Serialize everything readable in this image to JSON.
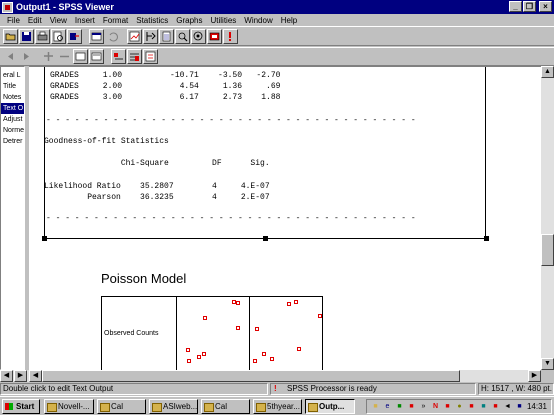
{
  "window": {
    "title": "Output1 - SPSS Viewer",
    "controls": [
      "_",
      "❐",
      "×"
    ]
  },
  "menu": [
    "File",
    "Edit",
    "View",
    "Insert",
    "Format",
    "Statistics",
    "Graphs",
    "Utilities",
    "Window",
    "Help"
  ],
  "toolbar1_icons": [
    "open-icon",
    "save-icon",
    "print-icon",
    "print-preview-icon",
    "export-icon",
    "dialog-recall-icon",
    "undo-icon",
    "goto-chart-icon",
    "goto-case-icon",
    "variables-icon",
    "find-icon",
    "use-sets-icon",
    "designate-window-icon",
    "syntax-icon"
  ],
  "toolbar2_icons": [
    "back-icon",
    "forward-icon",
    "promote-icon",
    "demote-icon",
    "expand-icon",
    "collapse-icon",
    "show-icon",
    "hide-icon",
    "insert-heading-icon"
  ],
  "outline": {
    "items": [
      {
        "label": "eral L",
        "selected": false
      },
      {
        "label": "Title",
        "selected": false
      },
      {
        "label": "Notes",
        "selected": false
      },
      {
        "label": "Text O",
        "selected": true
      },
      {
        "label": "Adjust",
        "selected": false
      },
      {
        "label": "Norme",
        "selected": false
      },
      {
        "label": "Detrer",
        "selected": false
      }
    ]
  },
  "output_text": {
    "grades_rows": [
      {
        "label": "GRADES",
        "value": "1.00",
        "c1": "-10.71",
        "c2": "-3.50",
        "c3": "-2.70"
      },
      {
        "label": "GRADES",
        "value": "2.00",
        "c1": "4.54",
        "c2": "1.36",
        "c3": ".69"
      },
      {
        "label": "GRADES",
        "value": "3.00",
        "c1": "6.17",
        "c2": "2.73",
        "c3": "1.88"
      }
    ],
    "dashes": "- - - - - - - - - - - - - - - - - - - - - - - - - - - - - - - - - - - - - - -",
    "gof_title": "Goodness-of-fit Statistics",
    "gof_headers": [
      "Chi-Square",
      "DF",
      "Sig."
    ],
    "gof_rows": [
      {
        "label": "Likelihood Ratio",
        "chisq": "35.2807",
        "df": "4",
        "sig": "4.E-07"
      },
      {
        "label": "Pearson",
        "chisq": "36.3235",
        "df": "4",
        "sig": "2.E-07"
      }
    ]
  },
  "poisson": {
    "title": "Poisson Model",
    "row_label": "Observed Counts"
  },
  "status": {
    "hint": "Double click to edit Text Output",
    "processor": "SPSS Processor  is ready",
    "dims": "H: 1517 , W: 480 pt."
  },
  "taskbar": {
    "start": "Start",
    "tasks": [
      {
        "label": "Novell-...",
        "active": false
      },
      {
        "label": "Cal",
        "active": false
      },
      {
        "label": "ASIweb...",
        "active": false
      },
      {
        "label": "Cal",
        "active": false
      },
      {
        "label": "5thyear...",
        "active": false
      },
      {
        "label": "Outp...",
        "active": true
      }
    ],
    "clock": "14:31"
  }
}
